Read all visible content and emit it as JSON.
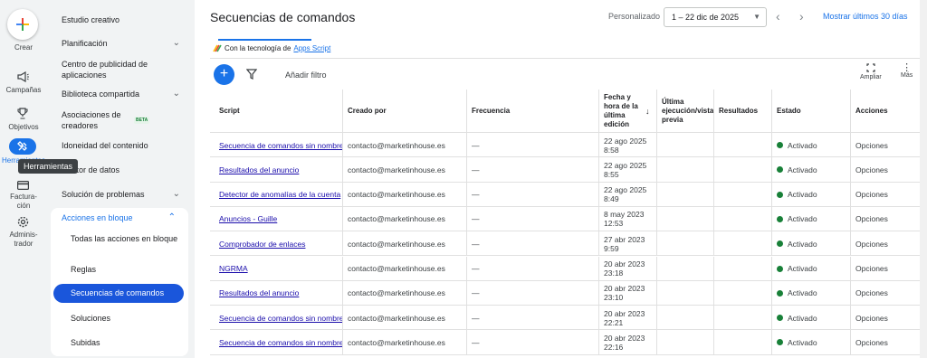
{
  "rail": {
    "create_label": "Crear",
    "items": [
      {
        "label": "Campañas",
        "icon": "megaphone-icon"
      },
      {
        "label": "Objetivos",
        "icon": "trophy-icon"
      },
      {
        "label": "Herramientas",
        "icon": "tools-icon"
      },
      {
        "label": "Factura-\nción",
        "icon": "credit-card-icon"
      },
      {
        "label": "Adminis-\ntrador",
        "icon": "gear-icon"
      }
    ],
    "tooltip": "Herramientas"
  },
  "nav": {
    "items": [
      {
        "label": "Estudio creativo"
      },
      {
        "label": "Planificación"
      },
      {
        "label": "Centro de publicidad de aplicaciones"
      },
      {
        "label": "Biblioteca compartida"
      },
      {
        "label": "Asociaciones de creadores"
      },
      {
        "label": "Idoneidad del contenido"
      },
      {
        "label": "Gestor de datos"
      },
      {
        "label": "Solución de problemas"
      }
    ],
    "beta_badge": "BETA",
    "bulk": {
      "header": "Acciones en bloque",
      "items": [
        {
          "label": "Todas las acciones en bloque"
        },
        {
          "label": "Reglas"
        },
        {
          "label": "Secuencias de comandos"
        },
        {
          "label": "Soluciones"
        },
        {
          "label": "Subidas"
        }
      ]
    }
  },
  "header": {
    "title": "Secuencias de comandos",
    "date_label": "Personalizado",
    "date_range": "1 – 22 dic de 2025",
    "show_last": "Mostrar últimos 30 días"
  },
  "powered": {
    "prefix": "Con la tecnología de",
    "link": "Apps Script"
  },
  "toolbar": {
    "add_filter": "Añadir filtro",
    "expand_label": "Ampliar",
    "more_label": "Más"
  },
  "table": {
    "columns": [
      "Script",
      "Creado por",
      "Frecuencia",
      "Fecha y hora de la última edición",
      "Última ejecución/vista previa",
      "Resultados",
      "Estado",
      "Acciones"
    ],
    "rows": [
      {
        "script": "Secuencia de comandos sin nombre",
        "creator": "contacto@marketinhouse.es",
        "freq": "—",
        "date": "22 ago 2025",
        "time": "8:58",
        "status": "Activado",
        "action": "Opciones"
      },
      {
        "script": "Resultados del anuncio",
        "creator": "contacto@marketinhouse.es",
        "freq": "—",
        "date": "22 ago 2025",
        "time": "8:55",
        "status": "Activado",
        "action": "Opciones"
      },
      {
        "script": "Detector de anomalías de la cuenta",
        "creator": "contacto@marketinhouse.es",
        "freq": "—",
        "date": "22 ago 2025",
        "time": "8:49",
        "status": "Activado",
        "action": "Opciones"
      },
      {
        "script": "Anuncios - Guille",
        "creator": "contacto@marketinhouse.es",
        "freq": "—",
        "date": "8 may 2023",
        "time": "12:53",
        "status": "Activado",
        "action": "Opciones"
      },
      {
        "script": "Comprobador de enlaces",
        "creator": "contacto@marketinhouse.es",
        "freq": "—",
        "date": "27 abr 2023",
        "time": "9:59",
        "status": "Activado",
        "action": "Opciones"
      },
      {
        "script": "NGRMA",
        "creator": "contacto@marketinhouse.es",
        "freq": "—",
        "date": "20 abr 2023",
        "time": "23:18",
        "status": "Activado",
        "action": "Opciones"
      },
      {
        "script": "Resultados del anuncio",
        "creator": "contacto@marketinhouse.es",
        "freq": "—",
        "date": "20 abr 2023",
        "time": "23:10",
        "status": "Activado",
        "action": "Opciones"
      },
      {
        "script": "Secuencia de comandos sin nombre",
        "creator": "contacto@marketinhouse.es",
        "freq": "—",
        "date": "20 abr 2023",
        "time": "22:21",
        "status": "Activado",
        "action": "Opciones"
      },
      {
        "script": "Secuencia de comandos sin nombre",
        "creator": "contacto@marketinhouse.es",
        "freq": "—",
        "date": "20 abr 2023",
        "time": "22:16",
        "status": "Activado",
        "action": "Opciones"
      }
    ]
  },
  "colors": {
    "accent": "#1a73e8",
    "status_active": "#188038"
  }
}
